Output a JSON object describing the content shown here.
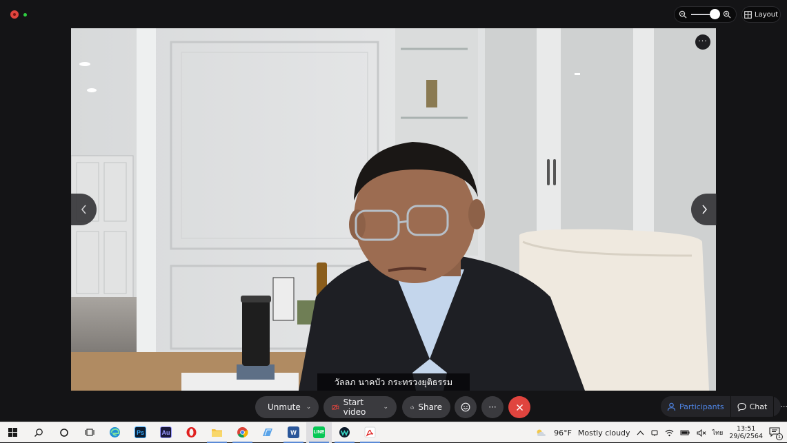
{
  "window": {
    "zoom_level": 0.85
  },
  "toolbar_top": {
    "layout_label": "Layout"
  },
  "video": {
    "more_label": "···",
    "caption": "วัลลภ นาคบัว กระทรวงยุติธรรม"
  },
  "controls": {
    "unmute_label": "Unmute",
    "start_video_label": "Start video",
    "share_label": "Share",
    "participants_label": "Participants",
    "chat_label": "Chat",
    "more_label": "···"
  },
  "taskbar": {
    "apps": [
      "windows-start",
      "search",
      "cortana",
      "task-view",
      "edge",
      "photoshop",
      "audition",
      "opera",
      "file-explorer",
      "chrome",
      "maps",
      "word",
      "line",
      "webex",
      "acrobat"
    ],
    "weather_temp": "96°F",
    "weather_desc": "Mostly cloudy",
    "input_lang": "ไทย",
    "time": "13:51",
    "date": "29/6/2564",
    "notification_count": "1"
  },
  "colors": {
    "end_call": "#e0443e",
    "accent_blue": "#4f86e8",
    "recording": "#2ecc40"
  }
}
